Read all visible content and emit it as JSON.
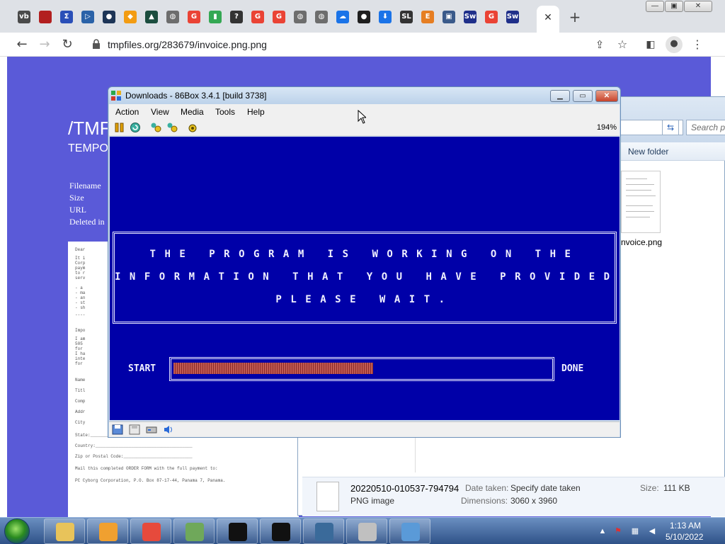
{
  "browser": {
    "url": "tmpfiles.org/283679/invoice.png.png",
    "tab_favicons": [
      {
        "icon": "vb-icon",
        "text": "vb",
        "color": "#4a4a4a"
      },
      {
        "icon": "red-square-icon",
        "text": "",
        "color": "#b21f1f"
      },
      {
        "icon": "sigma-icon",
        "text": "Σ",
        "color": "#2a4fb8"
      },
      {
        "icon": "play-store-icon",
        "text": "▷",
        "color": "#2a62a8"
      },
      {
        "icon": "chrome-dark-icon",
        "text": "●",
        "color": "#1d3557"
      },
      {
        "icon": "diamond-icon",
        "text": "◆",
        "color": "#f39c12"
      },
      {
        "icon": "dark-triangle-icon",
        "text": "▲",
        "color": "#1b4d3e"
      },
      {
        "icon": "globe-icon",
        "text": "◍",
        "color": "#6d6d6d"
      },
      {
        "icon": "google-icon",
        "text": "G",
        "color": "#ea4335"
      },
      {
        "icon": "chart-icon",
        "text": "▮",
        "color": "#34a853"
      },
      {
        "icon": "question-icon",
        "text": "?",
        "color": "#333333"
      },
      {
        "icon": "google-icon",
        "text": "G",
        "color": "#ea4335"
      },
      {
        "icon": "google-icon",
        "text": "G",
        "color": "#ea4335"
      },
      {
        "icon": "globe-icon",
        "text": "◍",
        "color": "#6d6d6d"
      },
      {
        "icon": "globe-icon",
        "text": "◍",
        "color": "#6d6d6d"
      },
      {
        "icon": "cloud-icon",
        "text": "☁",
        "color": "#1a73e8"
      },
      {
        "icon": "github-icon",
        "text": "●",
        "color": "#1f1f1f"
      },
      {
        "icon": "download-icon",
        "text": "⬇",
        "color": "#1a73e8"
      },
      {
        "icon": "sl-icon",
        "text": "SL",
        "color": "#333333"
      },
      {
        "icon": "e-icon",
        "text": "E",
        "color": "#e67e22"
      },
      {
        "icon": "floppy-icon",
        "text": "▣",
        "color": "#3a5a8a"
      },
      {
        "icon": "sw-icon",
        "text": "Sw",
        "color": "#1f2f8a"
      },
      {
        "icon": "google-icon",
        "text": "G",
        "color": "#ea4335"
      },
      {
        "icon": "sw-icon",
        "text": "Sw",
        "color": "#1f2f8a"
      }
    ],
    "close_tab": "✕",
    "new_tab": "+"
  },
  "tmpfiles_page": {
    "title": "/TMF",
    "subtitle": "TEMPO",
    "meta": [
      "Filename",
      "Size",
      "URL",
      "Deleted in"
    ],
    "doc_lines": [
      "Dear",
      "It i",
      "Corp",
      "paym",
      "to r",
      "serv",
      "- a",
      "- ma",
      "- an",
      "- st",
      "- sh",
      "----",
      "Impo",
      "I am",
      "505",
      "for",
      "I ha",
      "inte",
      "for",
      "Name",
      "Titl",
      "Comp",
      "Addr",
      "City",
      "State:________________________________________",
      "Country:______________________________________",
      "Zip or Postal Code:___________________________",
      "Mail this completed ORDER FORM with the full payment to:",
      "PC Cyborg Corporation, P.O. Box 87-17-44, Panama 7, Panama."
    ]
  },
  "explorer": {
    "search_placeholder": "Search p",
    "new_folder": "New folder",
    "file_label": "nvoice.png",
    "details": {
      "name": "20220510-010537-794794",
      "type": "PNG image",
      "date_taken_label": "Date taken:",
      "date_taken_value": "Specify date taken",
      "dimensions_label": "Dimensions:",
      "dimensions_value": "3060 x 3960",
      "size_label": "Size:",
      "size_value": "111 KB"
    }
  },
  "box86": {
    "title": "Downloads - 86Box 3.4.1 [build 3738]",
    "menu": [
      "Action",
      "View",
      "Media",
      "Tools",
      "Help"
    ],
    "zoom": "194%",
    "message_lines": [
      "THE PROGRAM IS WORKING ON THE",
      "INFORMATION THAT YOU HAVE PROVIDED.",
      "PLEASE WAIT."
    ],
    "start_label": "START",
    "done_label": "DONE",
    "progress": 0.53
  },
  "taskbar": {
    "time": "1:13 AM",
    "date": "5/10/2022",
    "items": [
      {
        "icon": "file-explorer-icon",
        "color": "#e8c35a"
      },
      {
        "icon": "media-player-icon",
        "color": "#f0a030"
      },
      {
        "icon": "chrome-icon",
        "color": "#e64a3c"
      },
      {
        "icon": "monitor-icon",
        "color": "#6fa85a"
      },
      {
        "icon": "7zip-icon",
        "color": "#111111"
      },
      {
        "icon": "cmd-icon",
        "color": "#111111"
      },
      {
        "icon": "window-app-icon",
        "color": "#3a6a9a"
      },
      {
        "icon": "cd-drive-icon",
        "color": "#c0c0c0"
      },
      {
        "icon": "paint-icon",
        "color": "#5a9ad8"
      }
    ]
  }
}
